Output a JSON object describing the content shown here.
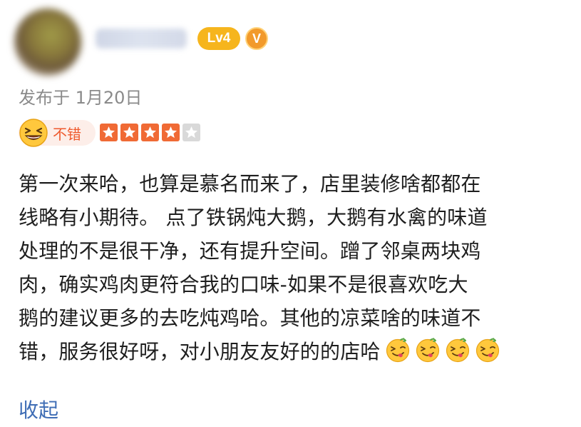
{
  "user": {
    "level_badge": "Lv4",
    "verified_badge": "V",
    "avatar_icon": "avatar-blurred",
    "name_icon": "username-blurred"
  },
  "review": {
    "date": "发布于 1月20日",
    "rating_label": "不错",
    "rating_icon": "grinning-face-emoji",
    "rating_stars": 4,
    "rating_max": 5,
    "content_lines": [
      "第一次来哈，也算是慕名而来了，店里装修啥都都在",
      "线略有小期待。 点了铁锅炖大鹅，大鹅有水禽的味道",
      "处理的不是很干净，还有提升空间。蹭了邻桌两块鸡",
      "肉，确实鸡肉更符合我的口味-如果不是很喜欢吃大",
      "鹅的建议更多的去吃炖鸡哈。其他的凉菜啥的味道不",
      "错，服务很好呀，对小朋友友好的的店哈"
    ],
    "trailing_emoji": "yummy-face-emoji",
    "trailing_emoji_count": 4,
    "collapse_label": "收起"
  },
  "colors": {
    "star_filled": "#f06a35",
    "star_empty": "#d9d9d9",
    "rating_text": "#ef5a2e",
    "link": "#3f6db5",
    "level_badge": "#f6b51d",
    "verified_badge": "#f29a2b"
  }
}
